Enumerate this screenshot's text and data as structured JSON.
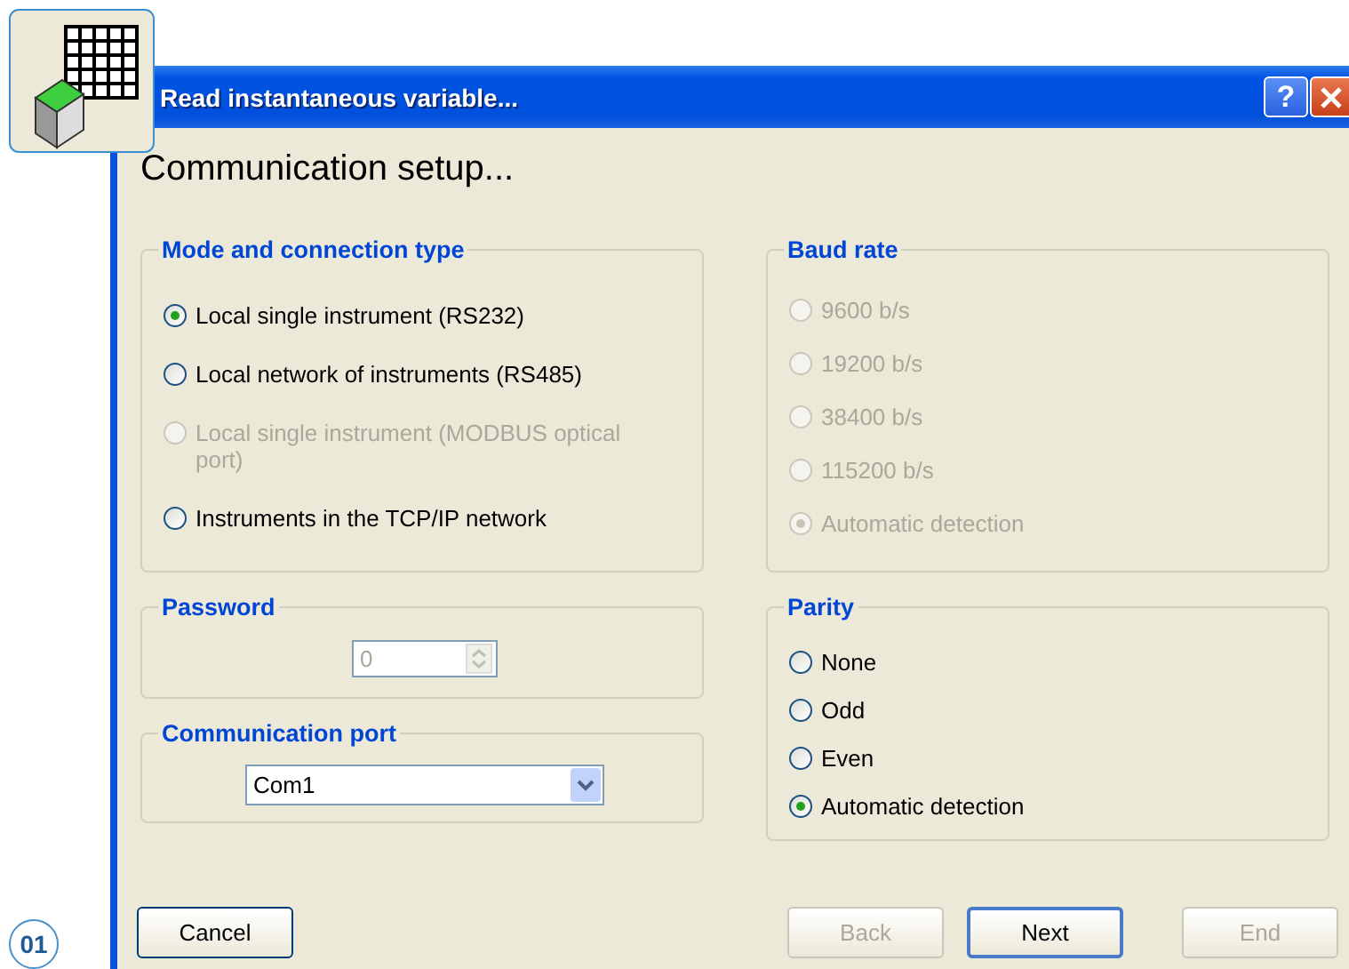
{
  "badge": "01",
  "window": {
    "title": "Read instantaneous variable...",
    "help_button": "?"
  },
  "heading": "Communication setup...",
  "mode": {
    "title": "Mode and connection type",
    "options": [
      {
        "label": "Local single instrument (RS232)",
        "selected": true,
        "disabled": false
      },
      {
        "label": "Local network of instruments (RS485)",
        "selected": false,
        "disabled": false
      },
      {
        "label": "Local single instrument (MODBUS optical port)",
        "selected": false,
        "disabled": true
      },
      {
        "label": "Instruments in the TCP/IP network",
        "selected": false,
        "disabled": false
      }
    ]
  },
  "password": {
    "title": "Password",
    "value": "0",
    "disabled": true
  },
  "port": {
    "title": "Communication port",
    "value": "Com1"
  },
  "baud": {
    "title": "Baud rate",
    "options": [
      {
        "label": "9600 b/s",
        "selected": false,
        "disabled": true
      },
      {
        "label": "19200 b/s",
        "selected": false,
        "disabled": true
      },
      {
        "label": "38400 b/s",
        "selected": false,
        "disabled": true
      },
      {
        "label": "115200 b/s",
        "selected": false,
        "disabled": true
      },
      {
        "label": "Automatic detection",
        "selected": true,
        "disabled": true
      }
    ]
  },
  "parity": {
    "title": "Parity",
    "options": [
      {
        "label": "None",
        "selected": false,
        "disabled": false
      },
      {
        "label": "Odd",
        "selected": false,
        "disabled": false
      },
      {
        "label": "Even",
        "selected": false,
        "disabled": false
      },
      {
        "label": "Automatic detection",
        "selected": true,
        "disabled": false
      }
    ]
  },
  "buttons": [
    {
      "label": "Cancel",
      "disabled": false,
      "default": false
    },
    {
      "label": "Back",
      "disabled": true,
      "default": false
    },
    {
      "label": "Next",
      "disabled": false,
      "default": true
    },
    {
      "label": "End",
      "disabled": true,
      "default": false
    }
  ]
}
